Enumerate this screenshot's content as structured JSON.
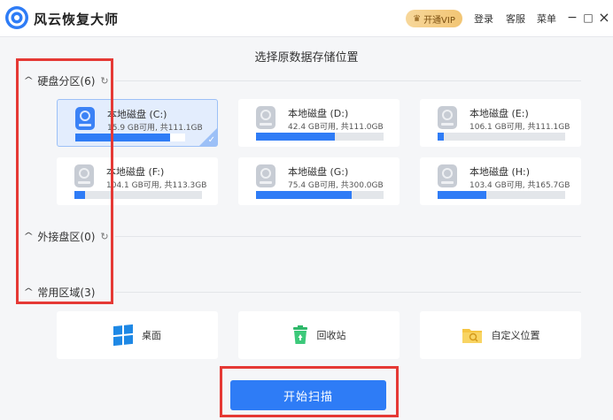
{
  "app": {
    "title": "风云恢复大师",
    "vip_label": "开通VIP",
    "login": "登录",
    "support": "客服",
    "menu": "菜单",
    "minimize": "−",
    "maximize": "□",
    "close": "×"
  },
  "main": {
    "heading": "选择原数据存储位置"
  },
  "groups": {
    "hard_disk": "硬盘分区(6)",
    "external": "外接盘区(0)",
    "common": "常用区域(3)"
  },
  "disks": [
    {
      "name": "本地磁盘 (C:)",
      "usage": "15.9 GB可用, 共111.1GB",
      "used_fraction": 0.86,
      "selected": true
    },
    {
      "name": "本地磁盘 (D:)",
      "usage": "42.4 GB可用, 共111.0GB",
      "used_fraction": 0.62,
      "selected": false
    },
    {
      "name": "本地磁盘 (E:)",
      "usage": "106.1 GB可用, 共111.1GB",
      "used_fraction": 0.05,
      "selected": false
    },
    {
      "name": "本地磁盘 (F:)",
      "usage": "104.1 GB可用, 共113.3GB",
      "used_fraction": 0.08,
      "selected": false
    },
    {
      "name": "本地磁盘 (G:)",
      "usage": "75.4 GB可用, 共300.0GB",
      "used_fraction": 0.75,
      "selected": false
    },
    {
      "name": "本地磁盘 (H:)",
      "usage": "103.4 GB可用, 共165.7GB",
      "used_fraction": 0.38,
      "selected": false
    }
  ],
  "common_areas": [
    {
      "label": "桌面",
      "icon": "windows-icon"
    },
    {
      "label": "回收站",
      "icon": "recycle-bin-icon"
    },
    {
      "label": "自定义位置",
      "icon": "folder-search-icon"
    }
  ],
  "scan_button": "开始扫描",
  "colors": {
    "accent": "#2e7cf6",
    "annotation": "#e53935",
    "vip": "#f2c574"
  }
}
